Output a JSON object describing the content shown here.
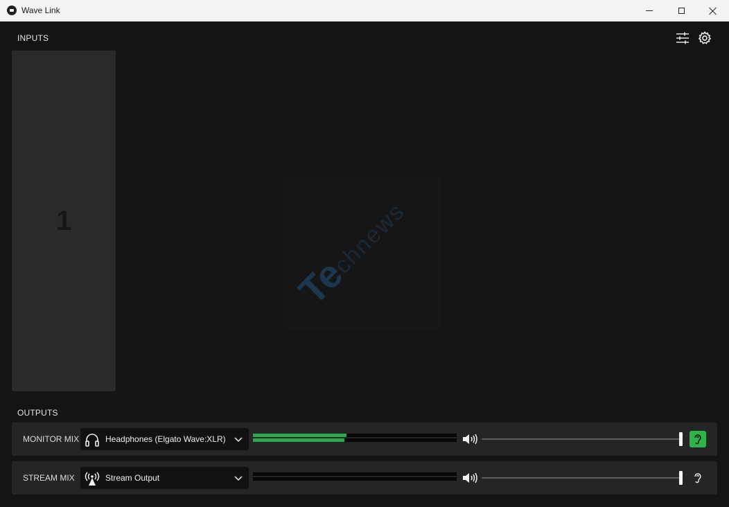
{
  "window": {
    "title": "Wave Link"
  },
  "inputs": {
    "label": "INPUTS",
    "cards": [
      {
        "number": "1"
      }
    ]
  },
  "outputs": {
    "label": "OUTPUTS",
    "mixes": [
      {
        "name": "MONITOR MIX",
        "device": "Headphones (Elgato Wave:XLR)",
        "device_icon": "headphones-icon",
        "level_left": 0.46,
        "level_right": 0.45,
        "volume": 1.0,
        "listening": true
      },
      {
        "name": "STREAM MIX",
        "device": "Stream Output",
        "device_icon": "broadcast-icon",
        "level_left": 0.0,
        "level_right": 0.0,
        "volume": 1.0,
        "listening": false
      }
    ]
  },
  "colors": {
    "accent": "#2db34a",
    "background": "#141414",
    "card": "#2a2a2a"
  },
  "toolbar": {
    "icons": [
      "mixer-settings-icon",
      "gear-icon"
    ]
  }
}
